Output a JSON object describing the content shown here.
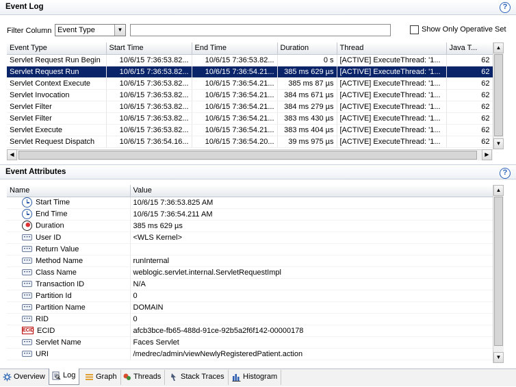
{
  "event_log": {
    "title": "Event Log",
    "help": "?",
    "filter_label": "Filter Column",
    "filter_column": "Event Type",
    "filter_text": "",
    "show_operative_label": "Show Only Operative Set",
    "columns": [
      "Event Type",
      "Start Time",
      "End Time",
      "Duration",
      "Thread",
      "Java T..."
    ],
    "rows": [
      {
        "type": "Servlet Request Run Begin",
        "start": "10/6/15 7:36:53.82...",
        "end": "10/6/15 7:36:53.82...",
        "duration": "0 s",
        "thread": "[ACTIVE] ExecuteThread: '1...",
        "java": "62"
      },
      {
        "type": "Servlet Request Run",
        "start": "10/6/15 7:36:53.82...",
        "end": "10/6/15 7:36:54.21...",
        "duration": "385 ms 629 µs",
        "thread": "[ACTIVE] ExecuteThread: '1...",
        "java": "62"
      },
      {
        "type": "Servlet Context Execute",
        "start": "10/6/15 7:36:53.82...",
        "end": "10/6/15 7:36:54.21...",
        "duration": "385 ms 87 µs",
        "thread": "[ACTIVE] ExecuteThread: '1...",
        "java": "62"
      },
      {
        "type": "Servlet Invocation",
        "start": "10/6/15 7:36:53.82...",
        "end": "10/6/15 7:36:54.21...",
        "duration": "384 ms 671 µs",
        "thread": "[ACTIVE] ExecuteThread: '1...",
        "java": "62"
      },
      {
        "type": "Servlet Filter",
        "start": "10/6/15 7:36:53.82...",
        "end": "10/6/15 7:36:54.21...",
        "duration": "384 ms 279 µs",
        "thread": "[ACTIVE] ExecuteThread: '1...",
        "java": "62"
      },
      {
        "type": "Servlet Filter",
        "start": "10/6/15 7:36:53.82...",
        "end": "10/6/15 7:36:54.21...",
        "duration": "383 ms 430 µs",
        "thread": "[ACTIVE] ExecuteThread: '1...",
        "java": "62"
      },
      {
        "type": "Servlet Execute",
        "start": "10/6/15 7:36:53.82...",
        "end": "10/6/15 7:36:54.21...",
        "duration": "383 ms 404 µs",
        "thread": "[ACTIVE] ExecuteThread: '1...",
        "java": "62"
      },
      {
        "type": "Servlet Request Dispatch",
        "start": "10/6/15 7:36:54.16...",
        "end": "10/6/15 7:36:54.20...",
        "duration": "39 ms 975 µs",
        "thread": "[ACTIVE] ExecuteThread: '1...",
        "java": "62"
      }
    ],
    "selected_row": 1
  },
  "event_attributes": {
    "title": "Event Attributes",
    "help": "?",
    "columns": [
      "Name",
      "Value"
    ],
    "rows": [
      {
        "icon": "clock-icon",
        "name": "Start Time",
        "value": "10/6/15 7:36:53.825 AM"
      },
      {
        "icon": "clock-icon",
        "name": "End Time",
        "value": "10/6/15 7:36:54.211 AM"
      },
      {
        "icon": "timer-icon",
        "name": "Duration",
        "value": "385 ms 629 µs"
      },
      {
        "icon": "field-icon",
        "name": "User ID",
        "value": "<WLS Kernel>"
      },
      {
        "icon": "field-icon",
        "name": "Return Value",
        "value": ""
      },
      {
        "icon": "field-icon",
        "name": "Method Name",
        "value": "runInternal"
      },
      {
        "icon": "field-icon",
        "name": "Class Name",
        "value": "weblogic.servlet.internal.ServletRequestImpl"
      },
      {
        "icon": "field-icon",
        "name": "Transaction ID",
        "value": "N/A"
      },
      {
        "icon": "field-icon",
        "name": "Partition Id",
        "value": "0"
      },
      {
        "icon": "field-icon",
        "name": "Partition Name",
        "value": "DOMAIN"
      },
      {
        "icon": "field-icon",
        "name": "RID",
        "value": "0"
      },
      {
        "icon": "ecid-icon",
        "name": "ECID",
        "value": "afcb3bce-fb65-488d-91ce-92b5a2f6f142-00000178"
      },
      {
        "icon": "field-icon",
        "name": "Servlet Name",
        "value": "Faces Servlet"
      },
      {
        "icon": "field-icon",
        "name": "URI",
        "value": "/medrec/admin/viewNewlyRegisteredPatient.action"
      }
    ]
  },
  "tabs": [
    {
      "label": "Overview",
      "icon": "overview-icon",
      "active": false
    },
    {
      "label": "Log",
      "icon": "log-icon",
      "active": true
    },
    {
      "label": "Graph",
      "icon": "graph-icon",
      "active": false
    },
    {
      "label": "Threads",
      "icon": "threads-icon",
      "active": false
    },
    {
      "label": "Stack Traces",
      "icon": "stack-traces-icon",
      "active": false
    },
    {
      "label": "Histogram",
      "icon": "histogram-icon",
      "active": false
    }
  ],
  "colors": {
    "selection": "#0a246a",
    "accent": "#2a62b8"
  }
}
